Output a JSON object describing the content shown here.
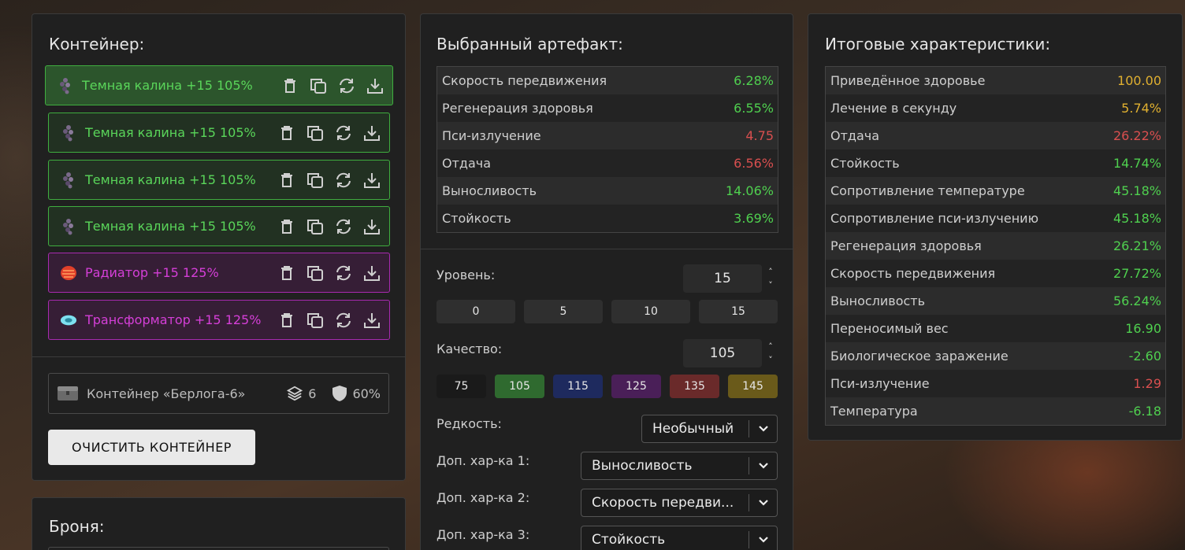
{
  "container": {
    "title": "Контейнер:",
    "items": [
      {
        "name": "Темная калина +15 105%",
        "icon": "berry-artifact-icon",
        "rarity": "green",
        "active": true
      },
      {
        "name": "Темная калина +15 105%",
        "icon": "berry-artifact-icon",
        "rarity": "green",
        "active": false
      },
      {
        "name": "Темная калина +15 105%",
        "icon": "berry-artifact-icon",
        "rarity": "green",
        "active": false
      },
      {
        "name": "Темная калина +15 105%",
        "icon": "berry-artifact-icon",
        "rarity": "green",
        "active": false
      },
      {
        "name": "Радиатор +15 125%",
        "icon": "radiator-artifact-icon",
        "rarity": "purple",
        "active": false
      },
      {
        "name": "Трансформатор +15 125%",
        "icon": "transformer-artifact-icon",
        "rarity": "purple",
        "active": false
      }
    ],
    "actions": [
      "trash-icon",
      "copy-icon",
      "refresh-icon",
      "download-icon"
    ],
    "storage_name": "Контейнер «Берлога-6»",
    "slots": "6",
    "protection": "60%",
    "clear_button": "ОЧИСТИТЬ КОНТЕЙНЕР"
  },
  "armor": {
    "title": "Броня:"
  },
  "artifact": {
    "title": "Выбранный артефакт:",
    "stats": [
      {
        "label": "Скорость передвижения",
        "value": "6.28%",
        "color": "g"
      },
      {
        "label": "Регенерация здоровья",
        "value": "6.55%",
        "color": "g"
      },
      {
        "label": "Пси-излучение",
        "value": "4.75",
        "color": "r"
      },
      {
        "label": "Отдача",
        "value": "6.56%",
        "color": "r"
      },
      {
        "label": "Выносливость",
        "value": "14.06%",
        "color": "g"
      },
      {
        "label": "Стойкость",
        "value": "3.69%",
        "color": "g"
      }
    ],
    "level_label": "Уровень:",
    "level_value": "15",
    "level_presets": [
      "0",
      "5",
      "10",
      "15"
    ],
    "quality_label": "Качество:",
    "quality_value": "105",
    "quality_presets": [
      {
        "label": "75",
        "color": "#1a1a1a"
      },
      {
        "label": "105",
        "color": "#2f6a2f"
      },
      {
        "label": "115",
        "color": "#1e2a5e"
      },
      {
        "label": "125",
        "color": "#4a1f58"
      },
      {
        "label": "135",
        "color": "#6a2a2a"
      },
      {
        "label": "145",
        "color": "#6a5a1a"
      }
    ],
    "rarity_label": "Редкость:",
    "rarity_value": "Необычный",
    "extra1_label": "Доп. хар-ка 1:",
    "extra1_value": "Выносливость",
    "extra2_label": "Доп. хар-ка 2:",
    "extra2_value": "Скорость передви...",
    "extra3_label": "Доп. хар-ка 3:",
    "extra3_value": "Стойкость"
  },
  "totals": {
    "title": "Итоговые характеристики:",
    "stats": [
      {
        "label": "Приведённое здоровье",
        "value": "100.00",
        "color": "y"
      },
      {
        "label": "Лечение в секунду",
        "value": "5.74%",
        "color": "y"
      },
      {
        "label": "Отдача",
        "value": "26.22%",
        "color": "r"
      },
      {
        "label": "Стойкость",
        "value": "14.74%",
        "color": "g"
      },
      {
        "label": "Сопротивление температуре",
        "value": "45.18%",
        "color": "g"
      },
      {
        "label": "Сопротивление пси-излучению",
        "value": "45.18%",
        "color": "g"
      },
      {
        "label": "Регенерация здоровья",
        "value": "26.21%",
        "color": "g"
      },
      {
        "label": "Скорость передвижения",
        "value": "27.72%",
        "color": "g"
      },
      {
        "label": "Выносливость",
        "value": "56.24%",
        "color": "g"
      },
      {
        "label": "Переносимый вес",
        "value": "16.90",
        "color": "g"
      },
      {
        "label": "Биологическое заражение",
        "value": "-2.60",
        "color": "g"
      },
      {
        "label": "Пси-излучение",
        "value": "1.29",
        "color": "r"
      },
      {
        "label": "Температура",
        "value": "-6.18",
        "color": "g"
      }
    ]
  }
}
